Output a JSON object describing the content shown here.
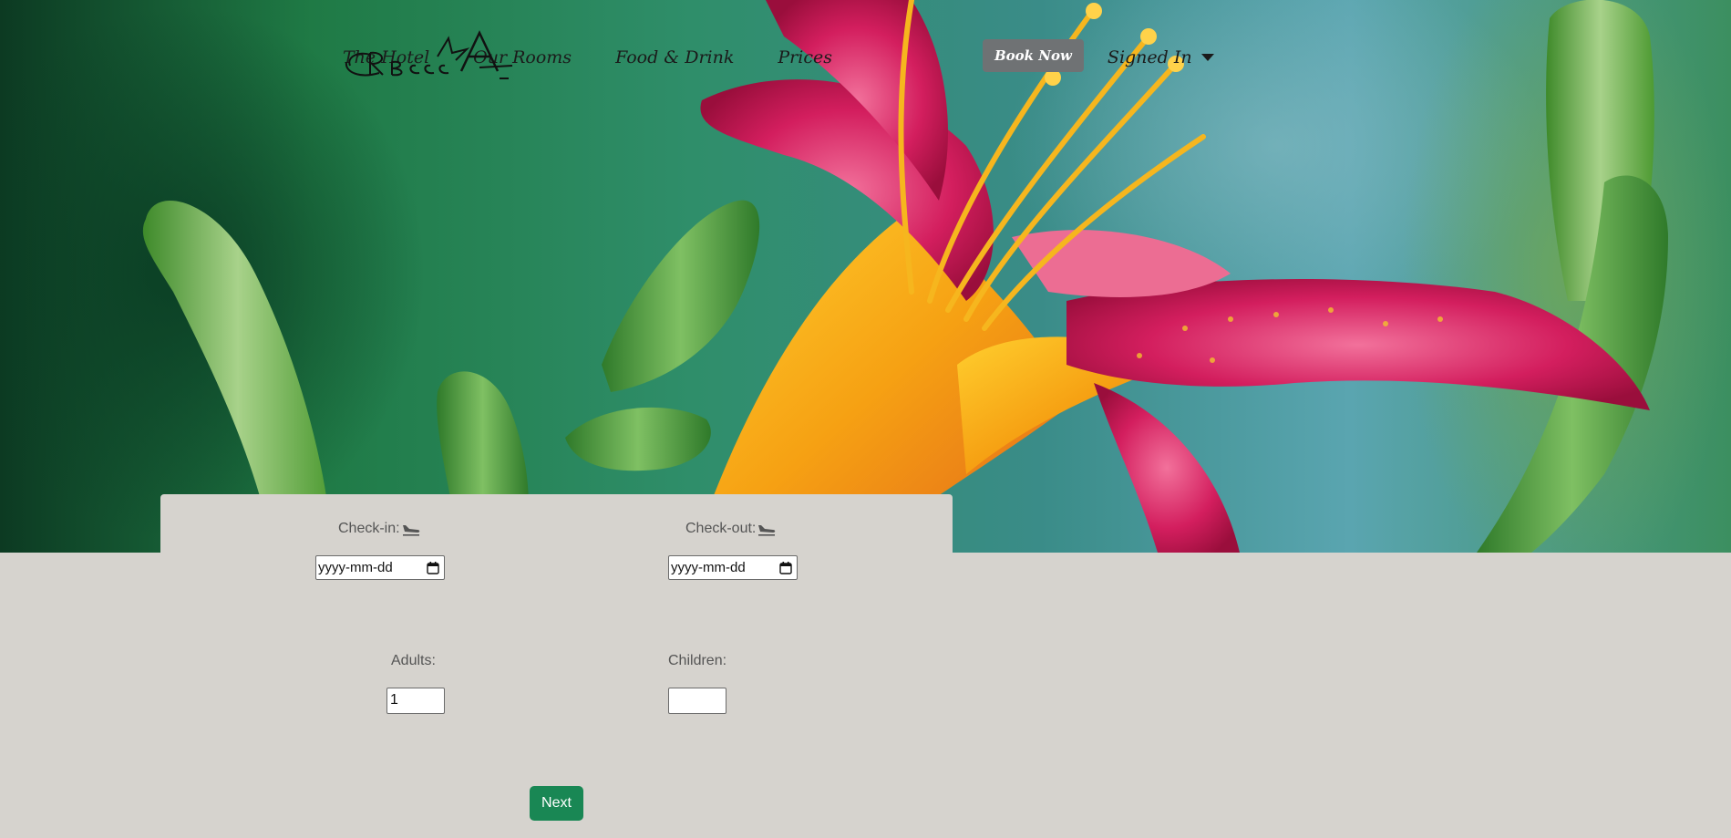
{
  "nav": {
    "items": [
      {
        "label": "The Hotel"
      },
      {
        "label": "Our Rooms"
      },
      {
        "label": "Food & Drink"
      },
      {
        "label": "Prices"
      }
    ],
    "book_label": "Book Now",
    "account_label": "Signed In"
  },
  "form": {
    "checkin_label": "Check-in:",
    "checkout_label": "Check-out:",
    "date_placeholder": "yyyy-mm-dd",
    "adults_label": "Adults:",
    "adults_value": "1",
    "children_label": "Children:",
    "children_value": "",
    "next_label": "Next"
  },
  "icons": {
    "checkin": "plane-landing-icon",
    "checkout": "plane-landing-icon",
    "calendar": "calendar-icon",
    "dropdown": "caret-down-icon"
  },
  "colors": {
    "primary_button": "#198754",
    "book_button": "#6f7274",
    "page_background": "#d6d3ce"
  }
}
